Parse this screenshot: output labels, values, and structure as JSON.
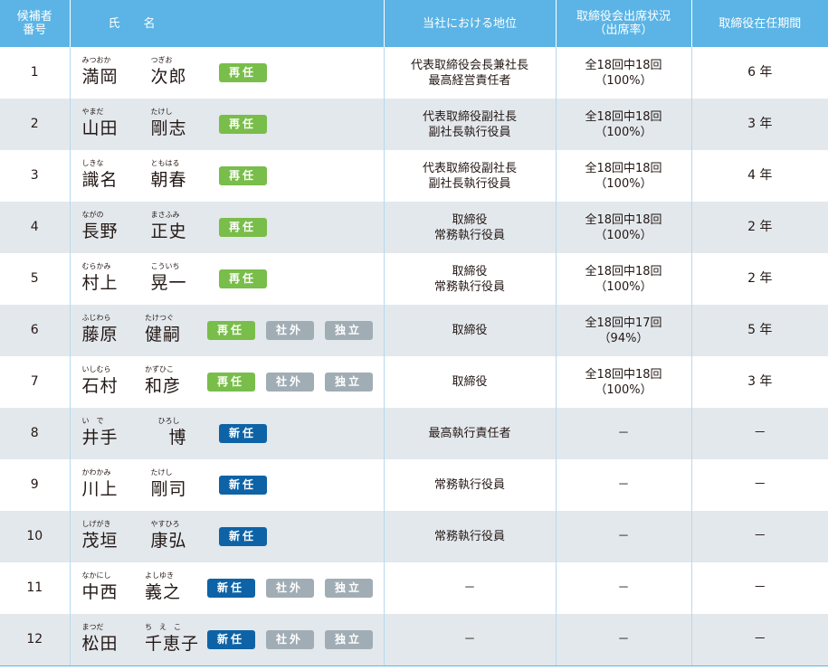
{
  "headers": {
    "no": [
      "候補者",
      "番号"
    ],
    "name": "氏　　名",
    "position": "当社における地位",
    "attendance": [
      "取締役会出席状況",
      "（出席率）"
    ],
    "term": "取締役在任期間"
  },
  "badge_labels": {
    "re": "再任",
    "new": "新任",
    "outside": "社外",
    "independent": "独立"
  },
  "candidates": [
    {
      "no": "1",
      "surname": "満岡",
      "surname_ruby": "みつおか",
      "given": "次郎",
      "given_ruby": "つぎお",
      "badges": [
        "re"
      ],
      "position": [
        "代表取締役会長兼社長",
        "最高経営責任者"
      ],
      "attendance": [
        "全18回中18回",
        "（100%）"
      ],
      "term": "6 年"
    },
    {
      "no": "2",
      "surname": "山田",
      "surname_ruby": "やまだ",
      "given": "剛志",
      "given_ruby": "たけし",
      "badges": [
        "re"
      ],
      "position": [
        "代表取締役副社長",
        "副社長執行役員"
      ],
      "attendance": [
        "全18回中18回",
        "（100%）"
      ],
      "term": "3 年"
    },
    {
      "no": "3",
      "surname": "識名",
      "surname_ruby": "しきな",
      "given": "朝春",
      "given_ruby": "ともはる",
      "badges": [
        "re"
      ],
      "position": [
        "代表取締役副社長",
        "副社長執行役員"
      ],
      "attendance": [
        "全18回中18回",
        "（100%）"
      ],
      "term": "4 年"
    },
    {
      "no": "4",
      "surname": "長野",
      "surname_ruby": "ながの",
      "given": "正史",
      "given_ruby": "まさふみ",
      "badges": [
        "re"
      ],
      "position": [
        "取締役",
        "常務執行役員"
      ],
      "attendance": [
        "全18回中18回",
        "（100%）"
      ],
      "term": "2 年"
    },
    {
      "no": "5",
      "surname": "村上",
      "surname_ruby": "むらかみ",
      "given": "晃一",
      "given_ruby": "こういち",
      "badges": [
        "re"
      ],
      "position": [
        "取締役",
        "常務執行役員"
      ],
      "attendance": [
        "全18回中18回",
        "（100%）"
      ],
      "term": "2 年"
    },
    {
      "no": "6",
      "surname": "藤原",
      "surname_ruby": "ふじわら",
      "given": "健嗣",
      "given_ruby": "たけつぐ",
      "badges": [
        "re",
        "outside",
        "independent"
      ],
      "position": [
        "取締役"
      ],
      "attendance": [
        "全18回中17回",
        "（94%）"
      ],
      "term": "5 年"
    },
    {
      "no": "7",
      "surname": "石村",
      "surname_ruby": "いしむら",
      "given": "和彦",
      "given_ruby": "かずひこ",
      "badges": [
        "re",
        "outside",
        "independent"
      ],
      "position": [
        "取締役"
      ],
      "attendance": [
        "全18回中18回",
        "（100%）"
      ],
      "term": "3 年"
    },
    {
      "no": "8",
      "surname": "井手",
      "surname_ruby": "い　で",
      "given": "　博",
      "given_ruby": "　ひろし",
      "badges": [
        "new"
      ],
      "position": [
        "最高執行責任者"
      ],
      "attendance": [
        "－"
      ],
      "term": "－"
    },
    {
      "no": "9",
      "surname": "川上",
      "surname_ruby": "かわかみ",
      "given": "剛司",
      "given_ruby": "たけし",
      "badges": [
        "new"
      ],
      "position": [
        "常務執行役員"
      ],
      "attendance": [
        "－"
      ],
      "term": "－"
    },
    {
      "no": "10",
      "surname": "茂垣",
      "surname_ruby": "しげがき",
      "given": "康弘",
      "given_ruby": "やすひろ",
      "badges": [
        "new"
      ],
      "position": [
        "常務執行役員"
      ],
      "attendance": [
        "－"
      ],
      "term": "－"
    },
    {
      "no": "11",
      "surname": "中西",
      "surname_ruby": "なかにし",
      "given": "義之",
      "given_ruby": "よしゆき",
      "badges": [
        "new",
        "outside",
        "independent"
      ],
      "position": [
        "－"
      ],
      "attendance": [
        "－"
      ],
      "term": "－"
    },
    {
      "no": "12",
      "surname": "松田",
      "surname_ruby": "まつだ",
      "given": "千恵子",
      "given_ruby": "ち　え　こ",
      "badges": [
        "new",
        "outside",
        "independent"
      ],
      "position": [
        "－"
      ],
      "attendance": [
        "－"
      ],
      "term": "－"
    }
  ]
}
